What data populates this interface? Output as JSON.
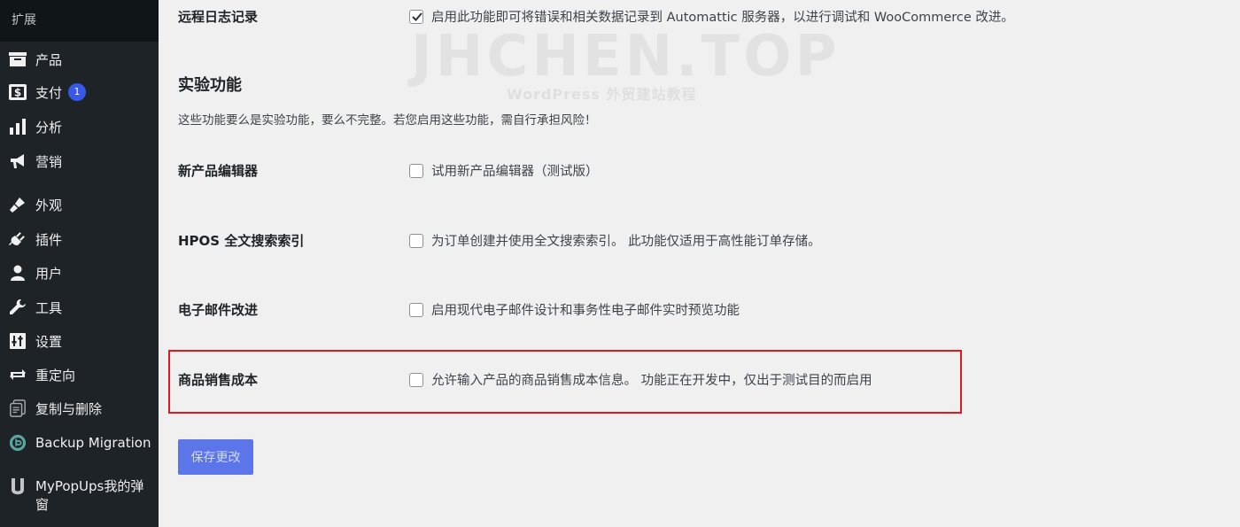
{
  "sidebar": {
    "top_label": "扩展",
    "items": [
      {
        "label": "产品",
        "icon": "archive-icon"
      },
      {
        "label": "支付",
        "icon": "dollar-icon",
        "badge": "1"
      },
      {
        "label": "分析",
        "icon": "bar-chart-icon"
      },
      {
        "label": "营销",
        "icon": "megaphone-icon"
      },
      {
        "label": "外观",
        "icon": "paintbrush-icon"
      },
      {
        "label": "插件",
        "icon": "plugin-icon"
      },
      {
        "label": "用户",
        "icon": "user-icon"
      },
      {
        "label": "工具",
        "icon": "wrench-icon"
      },
      {
        "label": "设置",
        "icon": "settings-icon"
      },
      {
        "label": "重定向",
        "icon": "redirect-icon"
      },
      {
        "label": "复制与删除",
        "icon": "copy-delete-icon"
      },
      {
        "label": "Backup Migration",
        "icon": "backup-icon"
      },
      {
        "label": "MyPopUps我的弹窗",
        "icon": "mypopups-icon"
      }
    ]
  },
  "watermark": {
    "main": "JHCHEN.TOP",
    "sub": "WordPress 外贸建站教程"
  },
  "remote_logging": {
    "label": "远程日志记录",
    "text": "启用此功能即可将错误和相关数据记录到 Automattic 服务器，以进行调试和 WooCommerce 改进。",
    "checked": true
  },
  "experimental": {
    "title": "实验功能",
    "description": "这些功能要么是实验功能，要么不完整。若您启用这些功能，需自行承担风险！"
  },
  "settings_rows": [
    {
      "label": "新产品编辑器",
      "text": "试用新产品编辑器（测试版）",
      "checked": false
    },
    {
      "label": "HPOS 全文搜索索引",
      "text": "为订单创建并使用全文搜索索引。 此功能仅适用于高性能订单存储。",
      "checked": false
    },
    {
      "label": "电子邮件改进",
      "text": "启用现代电子邮件设计和事务性电子邮件实时预览功能",
      "checked": false
    },
    {
      "label": "商品销售成本",
      "text": "允许输入产品的商品销售成本信息。 功能正在开发中，仅出于测试目的而启用",
      "checked": false
    }
  ],
  "save_button": {
    "label": "保存更改"
  },
  "colors": {
    "sidebar_bg": "#1d2327",
    "content_bg": "#f0f0f1",
    "accent": "#3858e9",
    "highlight_border": "#e0191f"
  }
}
